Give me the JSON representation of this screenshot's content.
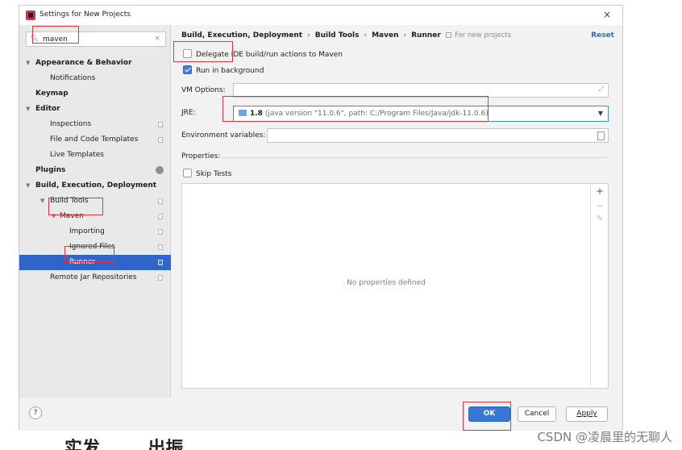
{
  "window": {
    "title": "Settings for New Projects",
    "close_glyph": "×"
  },
  "search": {
    "value": "maven",
    "icon": "search-icon",
    "clear_glyph": "×"
  },
  "tree": {
    "items": [
      {
        "label": "Appearance & Behavior",
        "bold": true,
        "arrow": "▼",
        "level": 0
      },
      {
        "label": "Notifications",
        "bold": false,
        "arrow": "",
        "level": 2
      },
      {
        "label": "Keymap",
        "bold": true,
        "arrow": "",
        "level": 0
      },
      {
        "label": "Editor",
        "bold": true,
        "arrow": "▼",
        "level": 0
      },
      {
        "label": "Inspections",
        "bold": false,
        "arrow": "",
        "level": 2
      },
      {
        "label": "File and Code Templates",
        "bold": false,
        "arrow": "",
        "level": 2
      },
      {
        "label": "Live Templates",
        "bold": false,
        "arrow": "",
        "level": 2
      },
      {
        "label": "Plugins",
        "bold": true,
        "arrow": "",
        "level": 0
      },
      {
        "label": "Build, Execution, Deployment",
        "bold": true,
        "arrow": "▼",
        "level": 0
      },
      {
        "label": "Build Tools",
        "bold": false,
        "arrow": "▼",
        "level": 2
      },
      {
        "label": "Maven",
        "bold": false,
        "arrow": "▼",
        "level": 3
      },
      {
        "label": "Importing",
        "bold": false,
        "arrow": "",
        "level": 4
      },
      {
        "label": "Ignored Files",
        "bold": false,
        "arrow": "",
        "level": 4
      },
      {
        "label": "Runner",
        "bold": false,
        "arrow": "",
        "level": 4
      },
      {
        "label": "Remote Jar Repositories",
        "bold": false,
        "arrow": "",
        "level": 2
      }
    ],
    "selected": "Runner"
  },
  "breadcrumb": {
    "parts": [
      "Build, Execution, Deployment",
      "Build Tools",
      "Maven",
      "Runner"
    ],
    "separator": "›",
    "for_new_projects": "For new projects",
    "reset": "Reset"
  },
  "options": {
    "delegate_label": "Delegate IDE build/run actions to Maven",
    "delegate_checked": false,
    "background_label": "Run in background",
    "background_checked": true,
    "vm_options_label": "VM Options:",
    "vm_options_value": "",
    "expand_glyph": "⤢",
    "jre_label": "JRE:",
    "jre_version": "1.8",
    "jre_detail": "(java version \"11.0.6\", path: C:/Program Files/Java/jdk-11.0.6)",
    "dropdown_glyph": "▼",
    "env_label": "Environment variables:",
    "env_value": "",
    "properties_label": "Properties:",
    "skip_tests_label": "Skip Tests",
    "skip_tests_checked": false
  },
  "properties": {
    "empty_text": "No properties defined",
    "add_glyph": "+",
    "remove_glyph": "−",
    "edit_glyph": "✎"
  },
  "buttons": {
    "help": "?",
    "ok": "OK",
    "cancel": "Cancel",
    "apply": "Apply"
  },
  "watermark": "CSDN @凌晨里的无聊人",
  "cut_text": "实发  ……  出振",
  "colors": {
    "selection": "#2f65ca",
    "highlight": "#e2343c",
    "primary_button": "#3778d4",
    "link": "#2470c2"
  }
}
